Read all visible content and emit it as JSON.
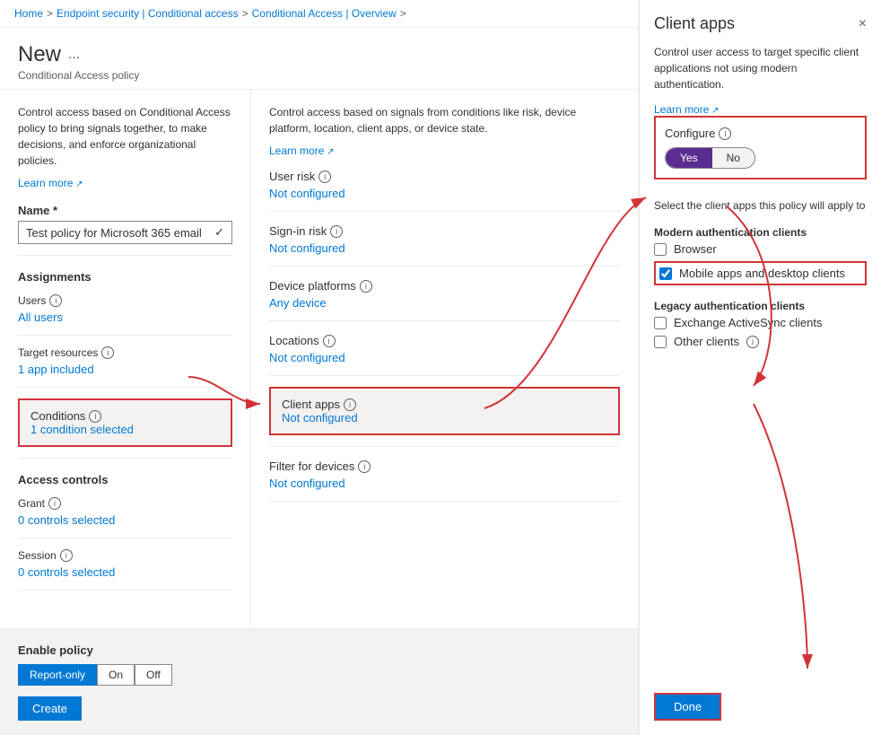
{
  "breadcrumb": {
    "items": [
      "Home",
      "Endpoint security | Conditional access",
      "Conditional Access | Overview"
    ],
    "separators": [
      ">",
      ">",
      ">"
    ]
  },
  "page": {
    "title": "New",
    "ellipsis": "...",
    "subtitle": "Conditional Access policy"
  },
  "left_col": {
    "description": "Control access based on Conditional Access policy to bring signals together, to make decisions, and enforce organizational policies.",
    "learn_more": "Learn more",
    "name_label": "Name *",
    "name_value": "Test policy for Microsoft 365 email",
    "assignments_label": "Assignments",
    "users_label": "Users",
    "users_info": "ℹ",
    "users_value": "All users",
    "target_resources_label": "Target resources",
    "target_resources_info": "ℹ",
    "target_resources_value": "1 app included",
    "conditions_label": "Conditions",
    "conditions_info": "ℹ",
    "conditions_value": "1 condition selected",
    "access_controls_label": "Access controls",
    "grant_label": "Grant",
    "grant_info": "ℹ",
    "grant_value": "0 controls selected",
    "session_label": "Session",
    "session_info": "ℹ",
    "session_value": "0 controls selected"
  },
  "right_col": {
    "description": "Control access based on signals from conditions like risk, device platform, location, client apps, or device state.",
    "learn_more": "Learn more",
    "user_risk_label": "User risk",
    "user_risk_info": "ℹ",
    "user_risk_value": "Not configured",
    "sign_in_risk_label": "Sign-in risk",
    "sign_in_risk_info": "ℹ",
    "sign_in_risk_value": "Not configured",
    "device_platforms_label": "Device platforms",
    "device_platforms_info": "ℹ",
    "device_platforms_value": "Any device",
    "locations_label": "Locations",
    "locations_info": "ℹ",
    "locations_value": "Not configured",
    "client_apps_label": "Client apps",
    "client_apps_info": "ℹ",
    "client_apps_value": "Not configured",
    "filter_devices_label": "Filter for devices",
    "filter_devices_info": "ℹ",
    "filter_devices_value": "Not configured"
  },
  "bottom": {
    "enable_label": "Enable policy",
    "toggle_report": "Report-only",
    "toggle_on": "On",
    "toggle_off": "Off",
    "create_btn": "Create"
  },
  "panel": {
    "title": "Client apps",
    "close": "×",
    "description": "Control user access to target specific client applications not using modern authentication.",
    "learn_more": "Learn more",
    "configure_label": "Configure",
    "yes_label": "Yes",
    "no_label": "No",
    "select_text": "Select the client apps this policy will apply to",
    "modern_auth_label": "Modern authentication clients",
    "browser_label": "Browser",
    "mobile_label": "Mobile apps and desktop clients",
    "legacy_auth_label": "Legacy authentication clients",
    "exchange_label": "Exchange ActiveSync clients",
    "other_label": "Other clients",
    "other_info": "ℹ",
    "done_label": "Done"
  }
}
